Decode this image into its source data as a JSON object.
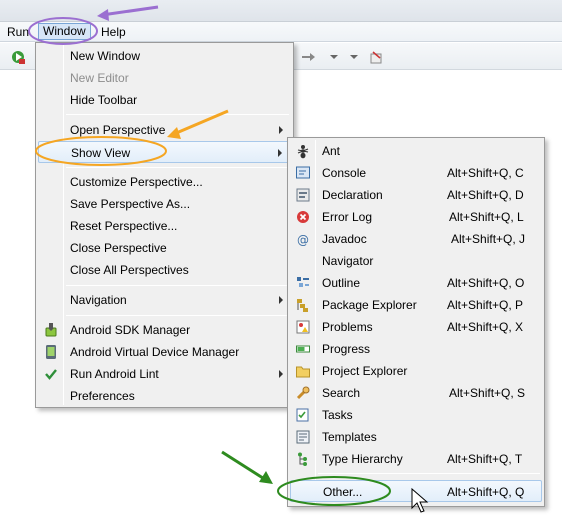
{
  "menubar": {
    "run_label": "Run",
    "window_label": "Window",
    "help_label": "Help"
  },
  "window_menu": {
    "items": [
      {
        "label": "New Window"
      },
      {
        "label": "New Editor"
      },
      {
        "label": "Hide Toolbar"
      },
      {
        "label": "Open Perspective"
      },
      {
        "label": "Show View"
      },
      {
        "label": "Customize Perspective..."
      },
      {
        "label": "Save Perspective As..."
      },
      {
        "label": "Reset Perspective..."
      },
      {
        "label": "Close Perspective"
      },
      {
        "label": "Close All Perspectives"
      },
      {
        "label": "Navigation"
      },
      {
        "label": "Android SDK Manager"
      },
      {
        "label": "Android Virtual Device Manager"
      },
      {
        "label": "Run Android Lint"
      },
      {
        "label": "Preferences"
      }
    ]
  },
  "show_view_menu": {
    "items": [
      {
        "label": "Ant",
        "shortcut": ""
      },
      {
        "label": "Console",
        "shortcut": "Alt+Shift+Q, C"
      },
      {
        "label": "Declaration",
        "shortcut": "Alt+Shift+Q, D"
      },
      {
        "label": "Error Log",
        "shortcut": "Alt+Shift+Q, L"
      },
      {
        "label": "Javadoc",
        "shortcut": "Alt+Shift+Q, J"
      },
      {
        "label": "Navigator",
        "shortcut": ""
      },
      {
        "label": "Outline",
        "shortcut": "Alt+Shift+Q, O"
      },
      {
        "label": "Package Explorer",
        "shortcut": "Alt+Shift+Q, P"
      },
      {
        "label": "Problems",
        "shortcut": "Alt+Shift+Q, X"
      },
      {
        "label": "Progress",
        "shortcut": ""
      },
      {
        "label": "Project Explorer",
        "shortcut": ""
      },
      {
        "label": "Search",
        "shortcut": "Alt+Shift+Q, S"
      },
      {
        "label": "Tasks",
        "shortcut": ""
      },
      {
        "label": "Templates",
        "shortcut": ""
      },
      {
        "label": "Type Hierarchy",
        "shortcut": "Alt+Shift+Q, T"
      },
      {
        "label": "Other...",
        "shortcut": "Alt+Shift+Q, Q"
      }
    ]
  },
  "annotation_colors": {
    "purple": "#9b6fd1",
    "orange": "#f5a623",
    "green": "#2e8b1f"
  }
}
